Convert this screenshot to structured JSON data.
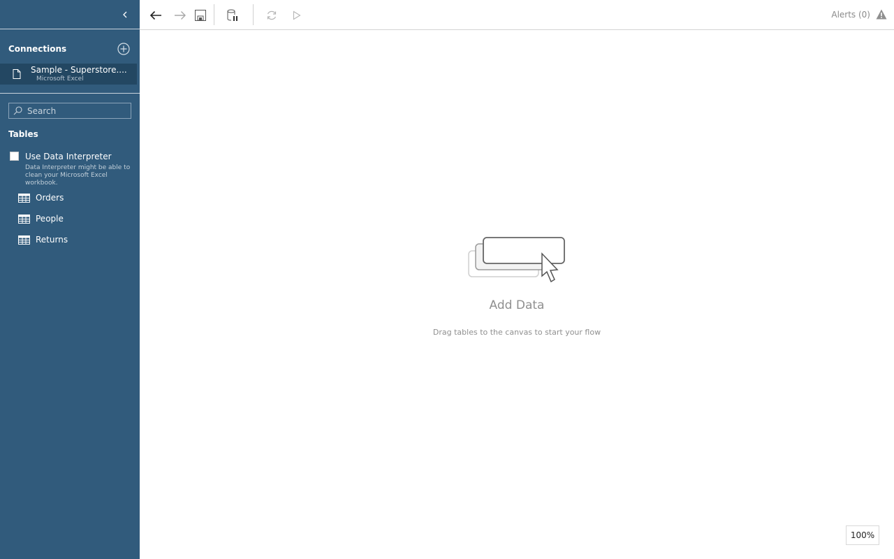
{
  "sidebar": {
    "connections_title": "Connections",
    "connection": {
      "name": "Sample - Superstore....",
      "type": "Microsoft Excel"
    },
    "search": {
      "placeholder": "Search",
      "value": ""
    },
    "tables_title": "Tables",
    "data_interpreter": {
      "label": "Use Data Interpreter",
      "checked": false,
      "description": "Data Interpreter might be able to clean your Microsoft Excel workbook."
    },
    "tables": [
      {
        "name": "Orders"
      },
      {
        "name": "People"
      },
      {
        "name": "Returns"
      }
    ]
  },
  "toolbar": {
    "buttons": [
      "undo",
      "redo",
      "save",
      "data-pause",
      "refresh",
      "run"
    ],
    "alerts_label": "Alerts (0)"
  },
  "canvas": {
    "title": "Add Data",
    "subtitle": "Drag tables to the canvas to start your flow",
    "zoom": "100%"
  }
}
